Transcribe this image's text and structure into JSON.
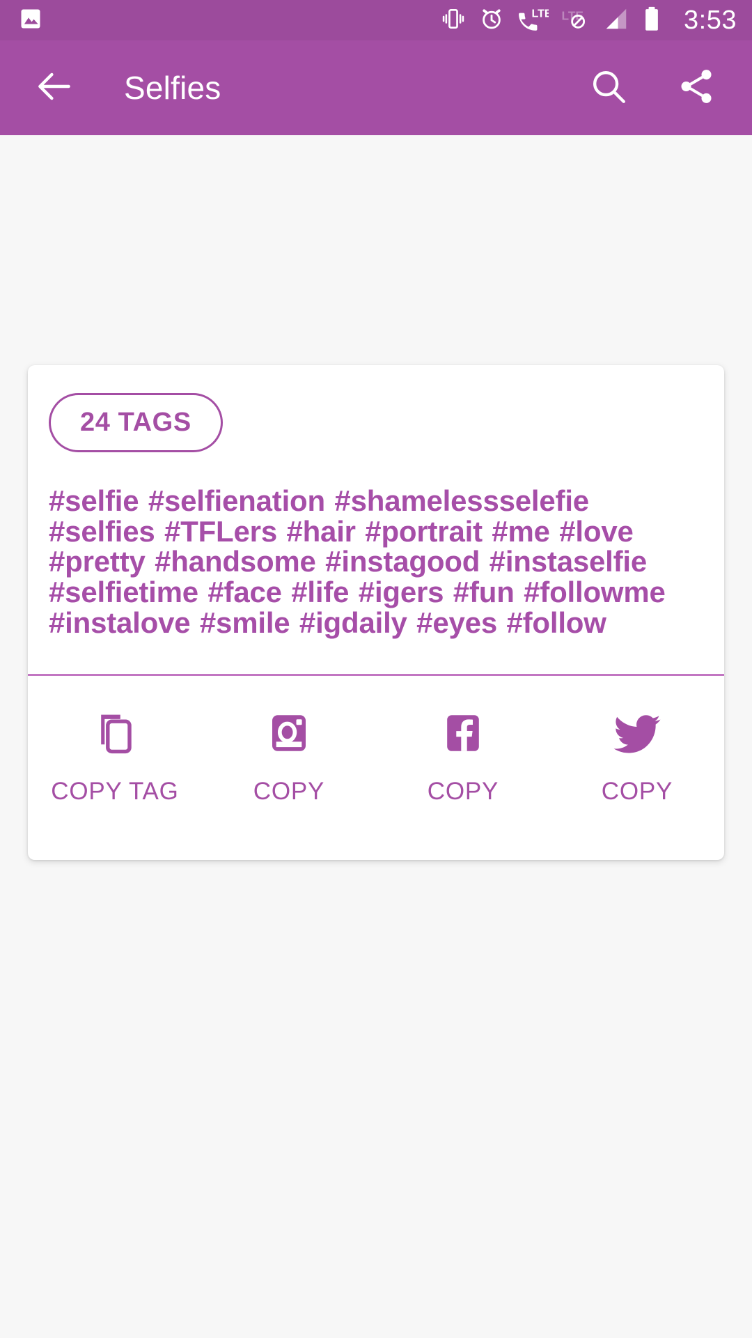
{
  "status_bar": {
    "background": "#9c4b9c",
    "time": "3:53",
    "icons": [
      "image-gallery-icon",
      "vibrate-icon",
      "alarm-clock-icon",
      "lte-call-icon",
      "lte-disabled-icon",
      "signal-bars-icon",
      "battery-full-icon"
    ]
  },
  "app_bar": {
    "background": "#a44ea4",
    "title": "Selfies",
    "back_icon": "arrow-back-icon",
    "search_icon": "search-icon",
    "share_icon": "share-icon"
  },
  "card": {
    "tag_count_label": "24 TAGS",
    "accent_color": "#a44ea4",
    "tags_text": "#selfie #selfienation #shamelessselefie #selfies #TFLers #hair #portrait #me #love #pretty #handsome #instagood #instaselfie #selfietime #face #life #igers #fun #followme #instalove #smile #igdaily #eyes #follow",
    "tags": [
      "#selfie",
      "#selfienation",
      "#shamelessselefie",
      "#selfies",
      "#TFLers",
      "#hair",
      "#portrait",
      "#me",
      "#love",
      "#pretty",
      "#handsome",
      "#instagood",
      "#instaselfie",
      "#selfietime",
      "#face",
      "#life",
      "#igers",
      "#fun",
      "#followme",
      "#instalove",
      "#smile",
      "#igdaily",
      "#eyes",
      "#follow"
    ],
    "actions": [
      {
        "icon": "copy-icon",
        "label": "COPY TAG"
      },
      {
        "icon": "instagram-icon",
        "label": "COPY"
      },
      {
        "icon": "facebook-icon",
        "label": "COPY"
      },
      {
        "icon": "twitter-icon",
        "label": "COPY"
      }
    ]
  }
}
